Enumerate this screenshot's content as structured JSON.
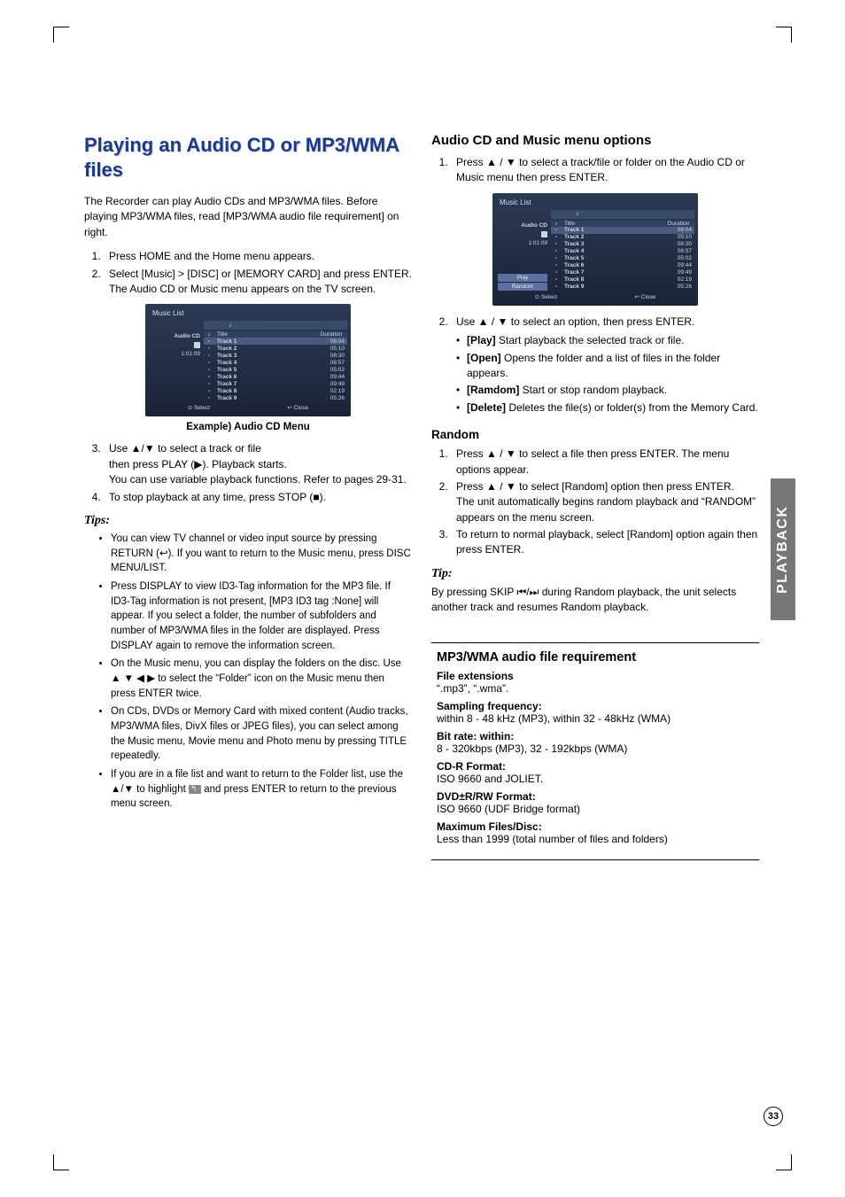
{
  "sidetab": "PLAYBACK",
  "page_number": "33",
  "left": {
    "h1": "Playing an Audio CD or MP3/WMA files",
    "intro": "The Recorder can play Audio CDs and MP3/WMA files. Before playing MP3/WMA files, read [MP3/WMA audio file requirement] on right.",
    "steps12": [
      "Press HOME and the Home menu appears.",
      "Select [Music] > [DISC] or [MEMORY CARD] and press ENTER."
    ],
    "steps12_note": "The Audio CD or Music menu appears on the TV screen.",
    "caption": "Example) Audio CD Menu",
    "step3_a": "Use ▲/▼ to select a track or file",
    "step3_b": "then press PLAY (▶). Playback starts.",
    "step3_c": "You can use variable playback functions. Refer to pages 29-31.",
    "step4": "To stop playback at any time, press STOP (■).",
    "tips_head": "Tips:",
    "tips": [
      "You can view TV channel or video input source by pressing RETURN (↩). If you want to return to the Music menu, press DISC MENU/LIST.",
      "Press DISPLAY to view ID3-Tag information for the MP3 file. If ID3-Tag information is not present, [MP3 ID3 tag :None] will appear. If you select a folder, the number of subfolders and number of MP3/WMA files in the folder are displayed. Press DISPLAY again to remove the information screen.",
      "On the Music menu, you can display the folders on the disc. Use ▲ ▼ ◀ ▶ to select the “Folder” icon on the Music menu then press ENTER twice.",
      "On CDs, DVDs or Memory Card with mixed content (Audio tracks, MP3/WMA files, DivX files or JPEG files), you can select among the Music menu, Movie menu and Photo menu by pressing TITLE repeatedly."
    ],
    "tip_folder_a": "If you are in a file list and want to return to the Folder list, use the ▲/▼ to highlight ",
    "tip_folder_b": " and press ENTER to return to the previous menu screen."
  },
  "right": {
    "h2a": "Audio CD and Music menu options",
    "step1": "Press ▲ / ▼ to select a track/file or folder on the Audio CD or Music menu then press ENTER.",
    "step2": "Use ▲ / ▼ to select an option, then press ENTER.",
    "opts": [
      {
        "k": "[Play]",
        "v": " Start playback the selected track or file."
      },
      {
        "k": "[Open]",
        "v": " Opens the folder and a list of files in the folder appears."
      },
      {
        "k": "[Ramdom]",
        "v": " Start or stop random playback."
      },
      {
        "k": "[Delete]",
        "v": " Deletes the file(s) or folder(s) from the Memory Card."
      }
    ],
    "random_h": "Random",
    "random_steps": [
      "Press ▲ / ▼ to select a file then press ENTER. The menu options appear.",
      "Press ▲ / ▼ to select [Random] option then press ENTER.\nThe unit automatically begins random playback and “RANDOM” appears on the menu screen.",
      "To return to normal playback, select [Random] option again then press ENTER."
    ],
    "tip_head": "Tip:",
    "tip_body": "By pressing SKIP ⏮/⏭ during Random playback, the unit selects another track and resumes Random playback.",
    "req_h": "MP3/WMA audio file requirement",
    "req": [
      {
        "k": "File extensions",
        "v": "“.mp3”, “.wma”."
      },
      {
        "k": "Sampling frequency:",
        "v": "within 8 - 48 kHz (MP3), within 32 - 48kHz (WMA)"
      },
      {
        "k": "Bit rate: within:",
        "v": "8 - 320kbps (MP3), 32 - 192kbps (WMA)"
      },
      {
        "k": "CD-R Format:",
        "v": "ISO 9660 and JOLIET."
      },
      {
        "k": "DVD±R/RW Format:",
        "v": "ISO 9660 (UDF Bridge format)"
      },
      {
        "k": "Maximum Files/Disc:",
        "v": "Less than 1999 (total number of files and folders)"
      }
    ]
  },
  "musiclist": {
    "title": "Music List",
    "left_label": "Audio CD",
    "elapsed": "1:01:09",
    "menu": [
      "Play",
      "Random"
    ],
    "head": {
      "c1": "♪",
      "c2": "Title",
      "c3": "Duration"
    },
    "rows": [
      {
        "t": "Track 1",
        "d": "08:04"
      },
      {
        "t": "Track 2",
        "d": "05:10"
      },
      {
        "t": "Track 3",
        "d": "08:30"
      },
      {
        "t": "Track 4",
        "d": "08:57"
      },
      {
        "t": "Track 5",
        "d": "05:02"
      },
      {
        "t": "Track 6",
        "d": "09:44"
      },
      {
        "t": "Track 7",
        "d": "09:49"
      },
      {
        "t": "Track 8",
        "d": "02:19"
      },
      {
        "t": "Track 9",
        "d": "05:26"
      }
    ],
    "foot_select": "⊙ Select",
    "foot_close": "↩ Close"
  }
}
